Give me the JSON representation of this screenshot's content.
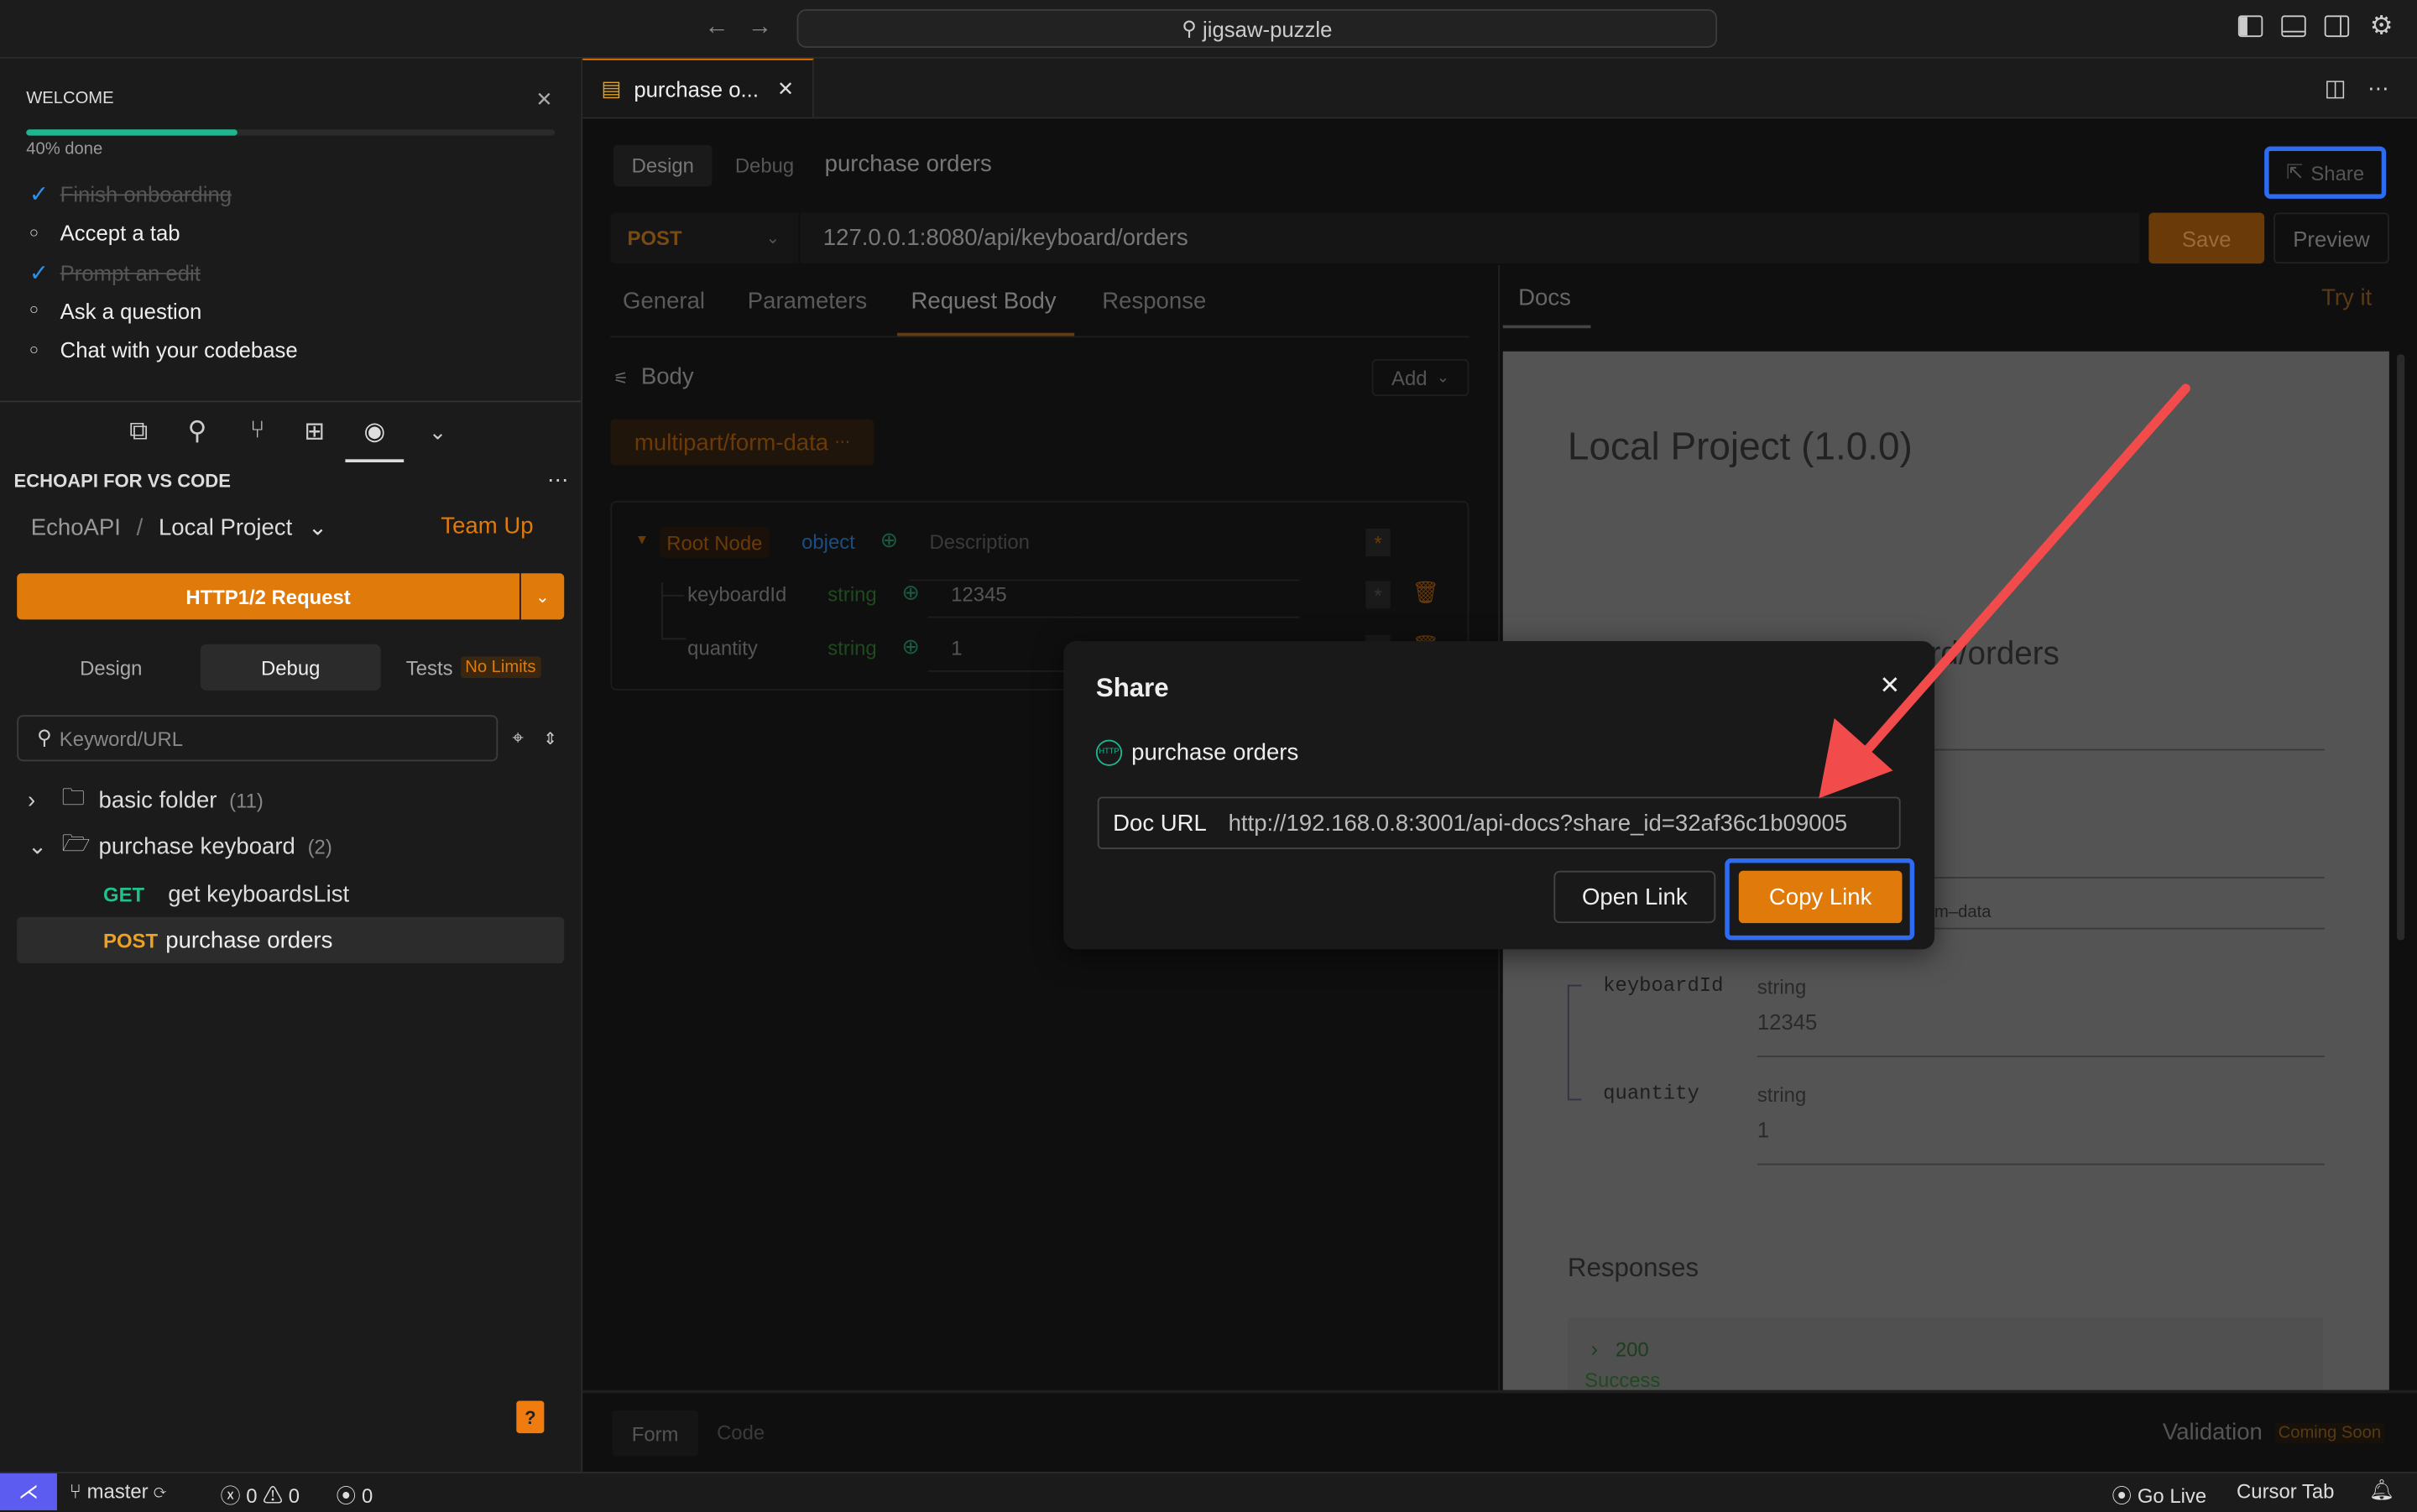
{
  "titlebar": {
    "search": "jigsaw-puzzle"
  },
  "welcome": {
    "title": "WELCOME",
    "progress_percent": 40,
    "progress_label": "40% done",
    "accent": "#1fb58f",
    "items": [
      {
        "label": "Finish onboarding",
        "done": true
      },
      {
        "label": "Accept a tab",
        "done": false
      },
      {
        "label": "Prompt an edit",
        "done": true
      },
      {
        "label": "Ask a question",
        "done": false
      },
      {
        "label": "Chat with your codebase",
        "done": false
      }
    ]
  },
  "sidebar": {
    "section_title": "ECHOAPI FOR VS CODE",
    "breadcrumb_root": "EchoAPI",
    "breadcrumb_sep": "/",
    "project": "Local Project",
    "team_up": "Team Up",
    "new_request": "HTTP1/2 Request",
    "tabs": [
      "Design",
      "Debug",
      "Tests"
    ],
    "tests_badge": "No Limits",
    "search_placeholder": "Keyword/URL",
    "tree": [
      {
        "label": "basic folder",
        "count": "(11)"
      },
      {
        "label": "purchase keyboard",
        "count": "(2)"
      }
    ],
    "requests": [
      {
        "method": "GET",
        "label": "get keyboardsList"
      },
      {
        "method": "POST",
        "label": "purchase orders"
      }
    ]
  },
  "editor": {
    "tab_label": "purchase o...",
    "mode_tabs": [
      "Design",
      "Debug"
    ],
    "request_name": "purchase orders",
    "share": "Share",
    "method": "POST",
    "url": "127.0.0.1:8080/api/keyboard/orders",
    "save": "Save",
    "preview": "Preview",
    "tabs": [
      "General",
      "Parameters",
      "Request Body",
      "Response"
    ],
    "active_tab": "Request Body",
    "body_label": "Body",
    "add": "Add",
    "body_type": "multipart/form-data",
    "schema": {
      "root": "Root Node",
      "root_type": "object",
      "desc_placeholder": "Description",
      "fields": [
        {
          "name": "keyboardId",
          "type": "string",
          "value": "12345"
        },
        {
          "name": "quantity",
          "type": "string",
          "value": "1"
        }
      ]
    },
    "bottom_tabs": [
      "Form",
      "Code"
    ],
    "validation": "Validation",
    "coming_soon": "Coming Soon"
  },
  "docs": {
    "tab": "Docs",
    "try_it": "Try it",
    "title": "Local Project (1.0.0)",
    "path_fragment": "rd/orders",
    "type_fragment": "m–data",
    "fields": [
      {
        "name": "keyboardId",
        "type": "string",
        "value": "12345"
      },
      {
        "name": "quantity",
        "type": "string",
        "value": "1"
      }
    ],
    "responses": "Responses",
    "status": "200",
    "status_text": "Success"
  },
  "modal": {
    "title": "Share",
    "api_name": "purchase orders",
    "url_label": "Doc URL",
    "url": "http://192.168.0.8:3001/api-docs?share_id=32af36c1b09005",
    "open": "Open Link",
    "copy": "Copy Link"
  },
  "statusbar": {
    "branch": "master",
    "errors": "0",
    "warnings": "0",
    "ports": "0",
    "go_live": "Go Live",
    "cursor_tab": "Cursor Tab"
  },
  "colors": {
    "orange": "#e07a0a",
    "highlight": "#2d6bf0",
    "arrow": "#f04a4a",
    "remote": "#5d5cf0"
  }
}
